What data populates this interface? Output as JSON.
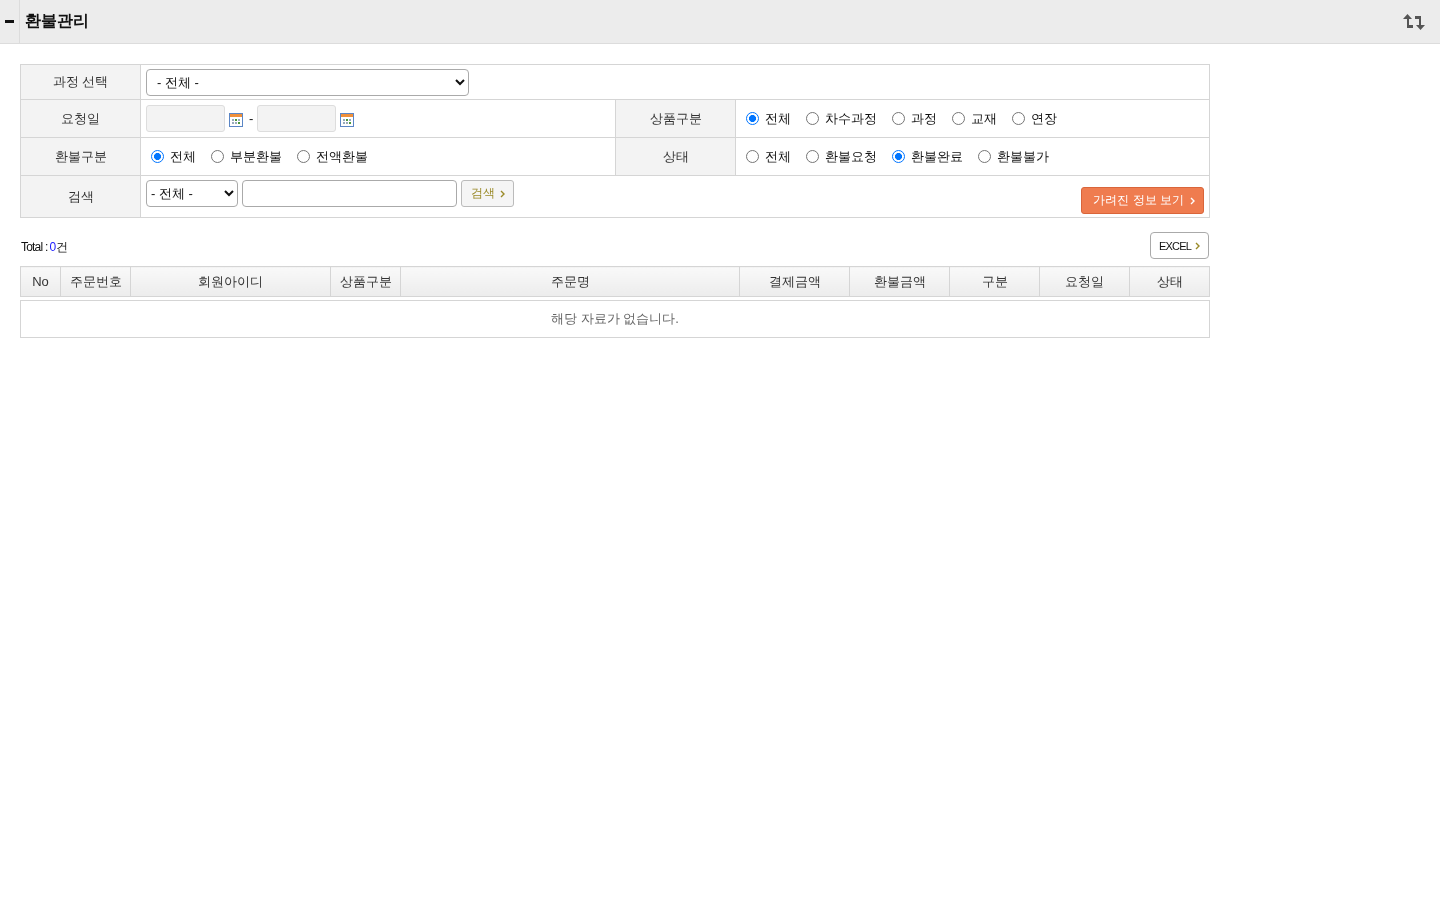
{
  "header": {
    "title": "환불관리"
  },
  "filters": {
    "course": {
      "label": "과정 선택",
      "value": "- 전체 -"
    },
    "request_date": {
      "label": "요청일",
      "separator": "-"
    },
    "product_type": {
      "label": "상품구분",
      "options": [
        {
          "label": "전체",
          "selected": true
        },
        {
          "label": "차수과정",
          "selected": false
        },
        {
          "label": "과정",
          "selected": false
        },
        {
          "label": "교재",
          "selected": false
        },
        {
          "label": "연장",
          "selected": false
        }
      ]
    },
    "refund_type": {
      "label": "환불구분",
      "options": [
        {
          "label": "전체",
          "selected": true
        },
        {
          "label": "부분환불",
          "selected": false
        },
        {
          "label": "전액환불",
          "selected": false
        }
      ]
    },
    "status": {
      "label": "상태",
      "options": [
        {
          "label": "전체",
          "selected": false
        },
        {
          "label": "환불요청",
          "selected": false
        },
        {
          "label": "환불완료",
          "selected": true
        },
        {
          "label": "환불불가",
          "selected": false
        }
      ]
    },
    "search": {
      "label": "검색",
      "field": "- 전체 -",
      "button": "검색"
    },
    "reveal_button": "가려진 정보 보기"
  },
  "summary": {
    "label": "Total :",
    "count": "0",
    "unit": "건"
  },
  "excel_button": "EXCEL",
  "table": {
    "columns": [
      "No",
      "주문번호",
      "회원아이디",
      "상품구분",
      "주문명",
      "결제금액",
      "환불금액",
      "구분",
      "요청일",
      "상태"
    ],
    "empty_message": "해당 자료가 없습니다."
  }
}
